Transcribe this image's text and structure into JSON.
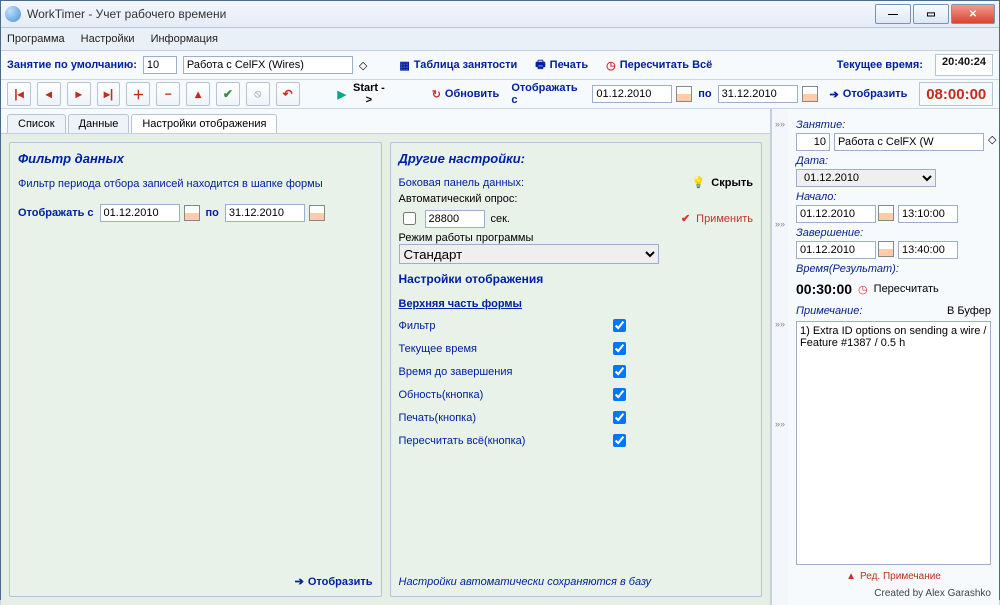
{
  "titlebar": {
    "title": "WorkTimer - Учет рабочего времени"
  },
  "menu": {
    "program": "Программа",
    "settings": "Настройки",
    "info": "Информация"
  },
  "tb1": {
    "default_task_lbl": "Занятие по умолчанию:",
    "default_task_id": "10",
    "default_task_name": "Работа с CelFX (Wires)",
    "busy_table": "Таблица занятости",
    "print": "Печать",
    "recalc_all": "Пересчитать Всё",
    "current_time_lbl": "Текущее время:",
    "current_time": "20:40:24"
  },
  "tb2": {
    "start": "Start ->",
    "refresh": "Обновить",
    "show_from_lbl": "Отображать с",
    "date_from": "01.12.2010",
    "to_lbl": "по",
    "date_to": "31.12.2010",
    "show": "Отобразить",
    "counter": "08:00:00"
  },
  "tabs": {
    "list": "Список",
    "data": "Данные",
    "display_settings": "Настройки отображения"
  },
  "filter": {
    "title": "Фильтр данных",
    "hint": "Фильтр периода отбора записей находится в шапке формы",
    "show_from": "Отображать с",
    "date_from": "01.12.2010",
    "to": "по",
    "date_to": "31.12.2010",
    "show_btn": "Отобразить"
  },
  "other": {
    "title": "Другие настройки:",
    "side_panel_lbl": "Боковая панель данных:",
    "hide": "Скрыть",
    "auto_poll_lbl": "Автоматический опрос:",
    "auto_poll_val": "28800",
    "sec": "сек.",
    "apply": "Применить",
    "mode_lbl": "Режим работы программы",
    "mode_val": "Стандарт",
    "display_hdr": "Настройки отображения",
    "top_hdr": "Верхняя часть формы",
    "chk_filter": "Фильтр",
    "chk_curtime": "Текущее время",
    "chk_time_to_end": "Время до завершения",
    "chk_obnost": "Обность(кнопка)",
    "chk_print": "Печать(кнопка)",
    "chk_recalc": "Пересчитать всё(кнопка)",
    "autosave": "Настройки автоматически сохраняются в базу"
  },
  "side": {
    "task_lbl": "Занятие:",
    "task_id": "10",
    "task_name": "Работа с CelFX (W",
    "date_lbl": "Дата:",
    "date": "01.12.2010",
    "start_lbl": "Начало:",
    "start_date": "01.12.2010",
    "start_time": "13:10:00",
    "end_lbl": "Завершение:",
    "end_date": "01.12.2010",
    "end_time": "13:40:00",
    "result_lbl": "Время(Результат):",
    "result_time": "00:30:00",
    "recalc": "Пересчитать",
    "note_lbl": "Примечание:",
    "to_buffer": "В Буфер",
    "note_text": "1) Extra ID options on sending a wire / Feature #1387 / 0.5 h",
    "edit_note": "Ред. Примечание",
    "credit": "Created by Alex Garashko"
  }
}
